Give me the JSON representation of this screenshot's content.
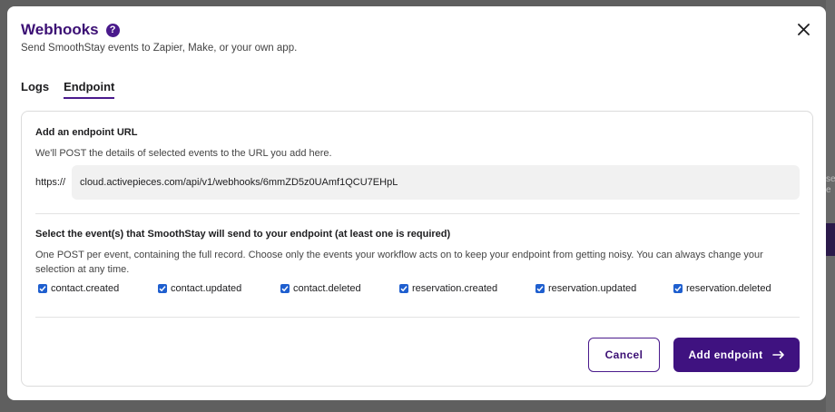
{
  "backdrop": {
    "snippet_1": "se",
    "snippet_2": "e"
  },
  "modal": {
    "title": "Webhooks",
    "help_glyph": "?",
    "subtitle": "Send SmoothStay events to Zapier, Make, or your own app."
  },
  "tabs": [
    {
      "label": "Logs",
      "active": false
    },
    {
      "label": "Endpoint",
      "active": true
    }
  ],
  "endpoint": {
    "title": "Add an endpoint URL",
    "description": "We'll POST the details of selected events to the URL you add here.",
    "protocol": "https://",
    "url_value": "cloud.activepieces.com/api/v1/webhooks/6mmZD5z0UAmf1QCU7EHpL"
  },
  "events_section": {
    "title": "Select the event(s) that SmoothStay will send to your endpoint (at least one is required)",
    "description": "One POST per event, containing the full record. Choose only the events your workflow acts on to keep your endpoint from getting noisy. You can always change your selection at any time.",
    "events": [
      {
        "label": "contact.created",
        "checked": true
      },
      {
        "label": "contact.updated",
        "checked": true
      },
      {
        "label": "contact.deleted",
        "checked": true
      },
      {
        "label": "reservation.created",
        "checked": true
      },
      {
        "label": "reservation.updated",
        "checked": true
      },
      {
        "label": "reservation.deleted",
        "checked": true
      }
    ]
  },
  "actions": {
    "cancel_label": "Cancel",
    "add_label": "Add endpoint"
  },
  "colors": {
    "brand": "#3f1280",
    "title": "#3b0f74",
    "checkbox": "#1f5fcf"
  },
  "icons": {
    "close": "close-icon",
    "help": "help-icon",
    "arrow": "arrow-right-icon",
    "check": "check-icon"
  }
}
